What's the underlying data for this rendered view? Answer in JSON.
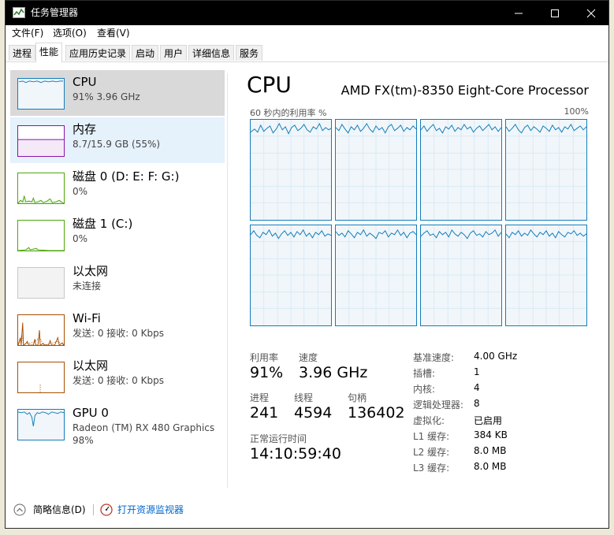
{
  "window": {
    "title": "任务管理器"
  },
  "menu": [
    "文件(F)",
    "选项(O)",
    "查看(V)"
  ],
  "tabs": [
    "进程",
    "性能",
    "应用历史记录",
    "启动",
    "用户",
    "详细信息",
    "服务"
  ],
  "sidebar": {
    "items": [
      {
        "name": "CPU",
        "detail": "91%  3.96 GHz"
      },
      {
        "name": "内存",
        "detail": "8.7/15.9 GB (55%)"
      },
      {
        "name": "磁盘 0 (D: E: F: G:)",
        "detail": "0%"
      },
      {
        "name": "磁盘 1 (C:)",
        "detail": "0%"
      },
      {
        "name": "以太网",
        "detail": "未连接"
      },
      {
        "name": "Wi-Fi",
        "detail": "发送: 0  接收: 0 Kbps"
      },
      {
        "name": "以太网",
        "detail": "发送: 0  接收: 0 Kbps"
      },
      {
        "name": "GPU 0",
        "detail": "Radeon (TM) RX 480 Graphics",
        "detail2": "98%"
      }
    ]
  },
  "main": {
    "title": "CPU",
    "model": "AMD FX(tm)-8350 Eight-Core Processor",
    "graph_label_left": "60 秒内的利用率 %",
    "graph_label_right": "100%",
    "stats": {
      "utilization_label": "利用率",
      "utilization_value": "91%",
      "speed_label": "速度",
      "speed_value": "3.96 GHz",
      "processes_label": "进程",
      "processes_value": "241",
      "threads_label": "线程",
      "threads_value": "4594",
      "handles_label": "句柄",
      "handles_value": "136402",
      "uptime_label": "正常运行时间",
      "uptime_value": "14:10:59:40"
    },
    "specs": [
      {
        "label": "基准速度:",
        "value": "4.00 GHz"
      },
      {
        "label": "插槽:",
        "value": "1"
      },
      {
        "label": "内核:",
        "value": "4"
      },
      {
        "label": "逻辑处理器:",
        "value": "8"
      },
      {
        "label": "虚拟化:",
        "value": "已启用"
      },
      {
        "label": "L1 缓存:",
        "value": "384 KB"
      },
      {
        "label": "L2 缓存:",
        "value": "8.0 MB"
      },
      {
        "label": "L3 缓存:",
        "value": "8.0 MB"
      }
    ]
  },
  "footer": {
    "fewer_details": "简略信息(D)",
    "open_monitor": "打开资源监视器"
  },
  "colors": {
    "cpu": "#117dbb",
    "memory": "#8b12ae",
    "disk": "#4da60c",
    "network": "#a74f01",
    "gpu": "#117dbb"
  }
}
